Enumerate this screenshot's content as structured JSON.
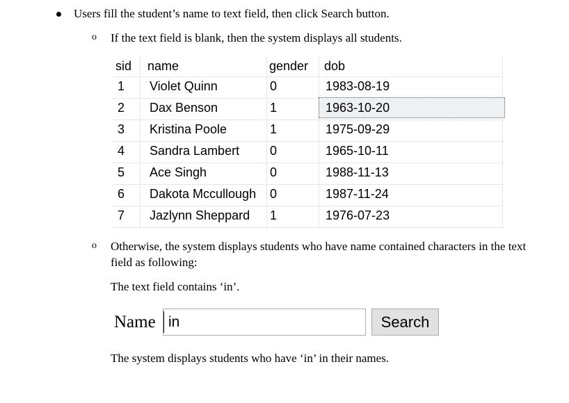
{
  "doc": {
    "bullet1": "Users fill the student’s name to text field, then click Search button.",
    "sub1": "If the text field is blank, then the system displays all students.",
    "sub2_line1": "Otherwise, the system displays students who have name contained characters in the text",
    "sub2_line2": "field as following:",
    "field_contains": "The text field contains ‘in’.",
    "result_text": "The system displays students who have ‘in’ in their names.",
    "sub_marker": "o"
  },
  "grid": {
    "columns": [
      "sid",
      "name",
      "gender",
      "dob"
    ],
    "rows": [
      {
        "sid": "1",
        "name": "Violet Quinn",
        "gender": "0",
        "dob": "1983-08-19"
      },
      {
        "sid": "2",
        "name": "Dax Benson",
        "gender": "1",
        "dob": "1963-10-20"
      },
      {
        "sid": "3",
        "name": "Kristina Poole",
        "gender": "1",
        "dob": "1975-09-29"
      },
      {
        "sid": "4",
        "name": "Sandra Lambert",
        "gender": "0",
        "dob": "1965-10-11"
      },
      {
        "sid": "5",
        "name": "Ace Singh",
        "gender": "0",
        "dob": "1988-11-13"
      },
      {
        "sid": "6",
        "name": "Dakota Mccullough",
        "gender": "0",
        "dob": "1987-11-24"
      },
      {
        "sid": "7",
        "name": "Jazlynn Sheppard",
        "gender": "1",
        "dob": "1976-07-23"
      }
    ]
  },
  "search": {
    "label": "Name",
    "value": "in",
    "button_label": "Search"
  }
}
